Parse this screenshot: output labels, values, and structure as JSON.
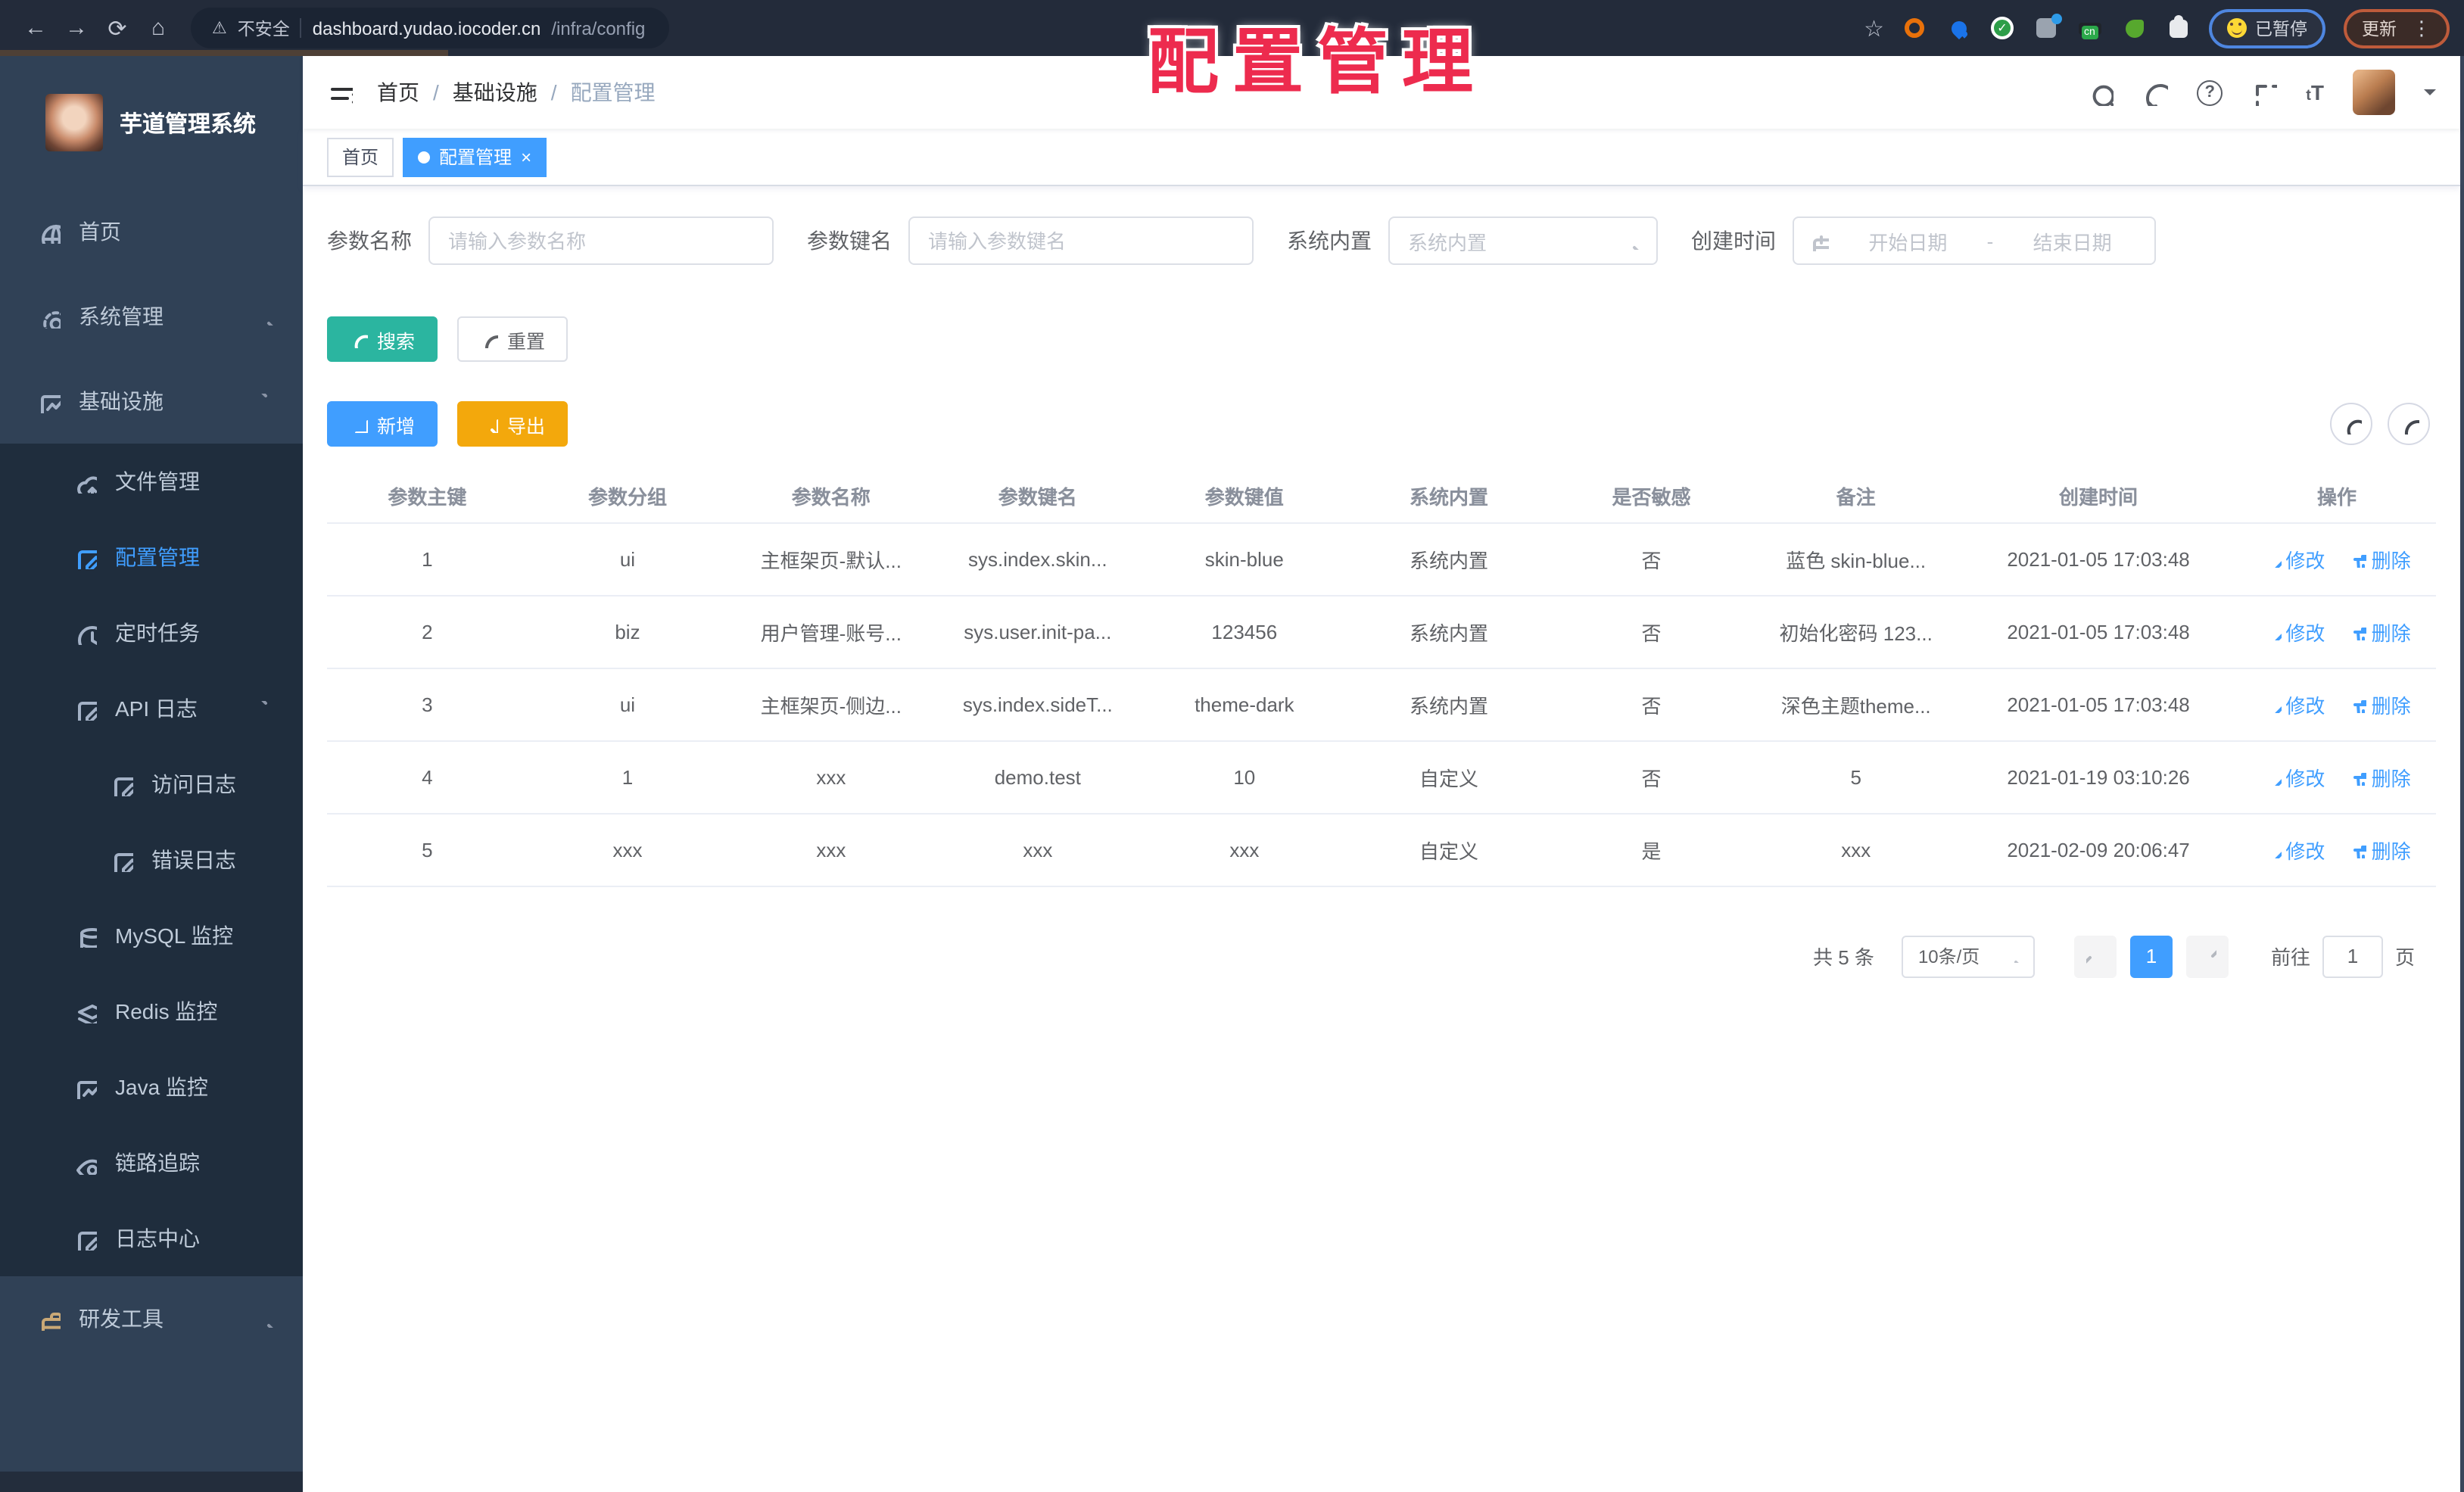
{
  "browser": {
    "security_label": "不安全",
    "url_host": "dashboard.yudao.iocoder.cn",
    "url_path": "/infra/config",
    "cn_badge": "cn",
    "paused_badge": "已暂停",
    "update_badge": "更新"
  },
  "watermark": "配置管理",
  "sidebar": {
    "app_title": "芋道管理系统",
    "menu": [
      {
        "label": "首页"
      },
      {
        "label": "系统管理"
      },
      {
        "label": "基础设施"
      },
      {
        "label": "文件管理"
      },
      {
        "label": "配置管理"
      },
      {
        "label": "定时任务"
      },
      {
        "label": "API 日志"
      },
      {
        "label": "访问日志"
      },
      {
        "label": "错误日志"
      },
      {
        "label": "MySQL 监控"
      },
      {
        "label": "Redis 监控"
      },
      {
        "label": "Java 监控"
      },
      {
        "label": "链路追踪"
      },
      {
        "label": "日志中心"
      },
      {
        "label": "研发工具"
      }
    ]
  },
  "header": {
    "breadcrumb": [
      "首页",
      "基础设施",
      "配置管理"
    ],
    "separator": "/"
  },
  "tabs": [
    {
      "label": "首页"
    },
    {
      "label": "配置管理"
    }
  ],
  "filters": {
    "name_label": "参数名称",
    "name_placeholder": "请输入参数名称",
    "key_label": "参数键名",
    "key_placeholder": "请输入参数键名",
    "type_label": "系统内置",
    "type_placeholder": "系统内置",
    "time_label": "创建时间",
    "start_placeholder": "开始日期",
    "range_separator": "-",
    "end_placeholder": "结束日期",
    "search_label": "搜索",
    "reset_label": "重置"
  },
  "toolbar": {
    "add_label": "新增",
    "export_label": "导出"
  },
  "table": {
    "columns": [
      "参数主键",
      "参数分组",
      "参数名称",
      "参数键名",
      "参数键值",
      "系统内置",
      "是否敏感",
      "备注",
      "创建时间",
      "操作"
    ],
    "edit_label": "修改",
    "delete_label": "删除",
    "rows": [
      {
        "cells": [
          "1",
          "ui",
          "主框架页-默认...",
          "sys.index.skin...",
          "skin-blue",
          "系统内置",
          "否",
          "蓝色 skin-blue...",
          "2021-01-05 17:03:48"
        ]
      },
      {
        "cells": [
          "2",
          "biz",
          "用户管理-账号...",
          "sys.user.init-pa...",
          "123456",
          "系统内置",
          "否",
          "初始化密码 123...",
          "2021-01-05 17:03:48"
        ]
      },
      {
        "cells": [
          "3",
          "ui",
          "主框架页-侧边...",
          "sys.index.sideT...",
          "theme-dark",
          "系统内置",
          "否",
          "深色主题theme...",
          "2021-01-05 17:03:48"
        ]
      },
      {
        "cells": [
          "4",
          "1",
          "xxx",
          "demo.test",
          "10",
          "自定义",
          "否",
          "5",
          "2021-01-19 03:10:26"
        ]
      },
      {
        "cells": [
          "5",
          "xxx",
          "xxx",
          "xxx",
          "xxx",
          "自定义",
          "是",
          "xxx",
          "2021-02-09 20:06:47"
        ]
      }
    ]
  },
  "pagination": {
    "total": "共 5 条",
    "page_size": "10条/页",
    "current_page": "1",
    "goto_label": "前往",
    "goto_value": "1",
    "page_label": "页"
  },
  "colors": {
    "accent": "#409EFF",
    "search_button": "#2BB5A0",
    "export_button": "#F3A80C",
    "watermark": "#ED2B4E",
    "sidebar_bg": "#304156",
    "submenu_bg": "#1F2D3D"
  }
}
